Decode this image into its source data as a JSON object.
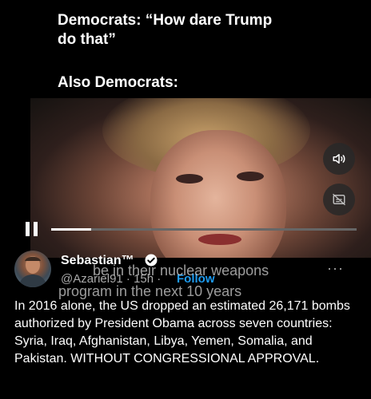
{
  "meme": {
    "line1": "Democrats: “How dare Trump",
    "line2": "do that”",
    "line3": "Also Democrats:"
  },
  "video": {
    "subtitle_line1": "be in their nuclear weapons",
    "subtitle_line2": "program in the next 10 years",
    "playback_progress": 0.13,
    "audio_icon": "speaker-icon",
    "captions_icon": "captions-off-icon"
  },
  "tweet": {
    "display_name": "Sebastian™",
    "handle": "@Azariel91 · 15h ·",
    "follow_label": "Follow",
    "more_label": "···",
    "body": "In 2016 alone, the US dropped an estimated 26,171 bombs authorized by President Obama across seven countries: Syria, Iraq, Afghanistan, Libya, Yemen, Somalia, and Pakistan. WITHOUT CONGRESSIONAL APPROVAL."
  }
}
